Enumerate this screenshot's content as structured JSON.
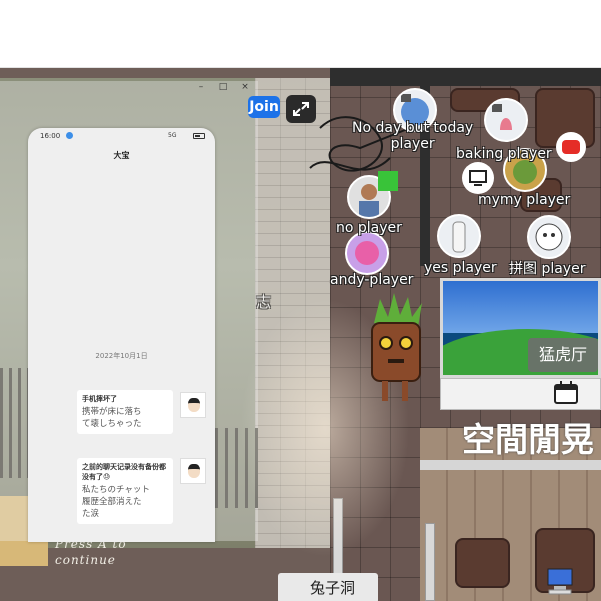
{
  "game": {
    "join_label": "Join",
    "press_text": "Press A to\ncontinue",
    "rooms": {
      "tiger_hall": "猛虎厅",
      "space": "空間閒晃",
      "rabbit_cave": "兔子洞",
      "partial_sign": "志"
    },
    "players": [
      {
        "label": "No day but today\nplayer"
      },
      {
        "label": "baking player"
      },
      {
        "label": "mymy player"
      },
      {
        "label": "no player"
      },
      {
        "label": "yes player"
      },
      {
        "label": "拼图 player"
      },
      {
        "label": "andy-player"
      }
    ]
  },
  "window": {
    "controls": [
      "–",
      "□",
      "×"
    ]
  },
  "phone": {
    "time": "16:00",
    "network": "5G",
    "chat_title": "大宝",
    "date": "2022年10月1日",
    "messages": [
      {
        "head": "手机摔坏了",
        "body": "携帯が床に落ち\nて壊しちゃった"
      },
      {
        "head": "之前的聊天记录没有备份都没有了😓",
        "body": "私たちのチャット\n履歴全部消えた\nた涙"
      }
    ],
    "input_icons": [
      "☺",
      "+"
    ]
  },
  "colors": {
    "join_blue": "#1d72e8",
    "chat_green": "#93d36a",
    "status_blue": "#3d8fe8"
  }
}
